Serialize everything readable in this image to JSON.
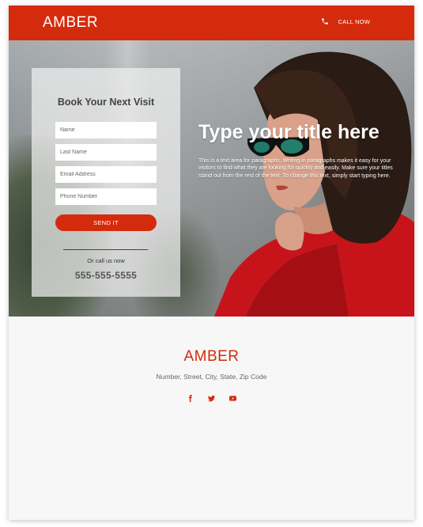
{
  "header": {
    "logo": "AMBER",
    "call_label": "CALL NOW",
    "phone_icon": "phone-icon"
  },
  "form": {
    "title": "Book Your Next Visit",
    "fields": [
      {
        "placeholder": "Name"
      },
      {
        "placeholder": "Last Name"
      },
      {
        "placeholder": "Email Address"
      },
      {
        "placeholder": "Phone Number"
      }
    ],
    "submit_label": "SEND IT",
    "or_call": "Or call us now",
    "phone": "555-555-5555"
  },
  "hero": {
    "title": "Type your title here",
    "text": "This is a text area for paragraphs. Writing in paragraphs makes it easy for your visitors to find what they are looking for quickly and easily. Make sure your titles stand out from the rest of the text. To change this text, simply start typing here."
  },
  "footer": {
    "logo": "AMBER",
    "address": "Number, Street, City, State, Zip Code",
    "social": [
      "facebook-icon",
      "twitter-icon",
      "youtube-icon"
    ]
  },
  "colors": {
    "accent": "#d52b0d",
    "footer_bg": "#f7f7f7"
  }
}
